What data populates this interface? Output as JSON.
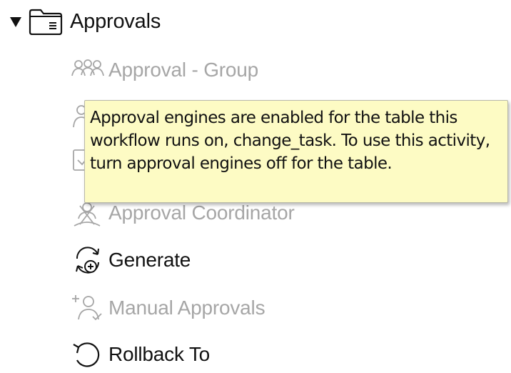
{
  "folder": {
    "label": "Approvals",
    "expanded": true,
    "caret_icon": "triangle-down-icon",
    "icon": "folder-icon"
  },
  "activities": [
    {
      "label": "Approval - Group",
      "icon": "people-group-icon",
      "enabled": false
    },
    {
      "label": "",
      "icon": "approval-icon",
      "enabled": false
    },
    {
      "label": "",
      "icon": "checkbox-icon",
      "enabled": false
    },
    {
      "label": "Approval Coordinator",
      "icon": "coordinator-icon",
      "enabled": false
    },
    {
      "label": "Generate",
      "icon": "generate-cycle-icon",
      "enabled": true
    },
    {
      "label": "Manual Approvals",
      "icon": "add-person-icon",
      "enabled": false
    },
    {
      "label": "Rollback To",
      "icon": "rollback-icon",
      "enabled": true
    }
  ],
  "tooltip": {
    "text": "Approval engines are enabled for the table this workflow runs on, change_task. To use this activity, turn approval engines off for the table."
  },
  "colors": {
    "enabled_text": "#111111",
    "disabled_text": "#a6a6a6",
    "tooltip_background": "#fdfbc4"
  }
}
